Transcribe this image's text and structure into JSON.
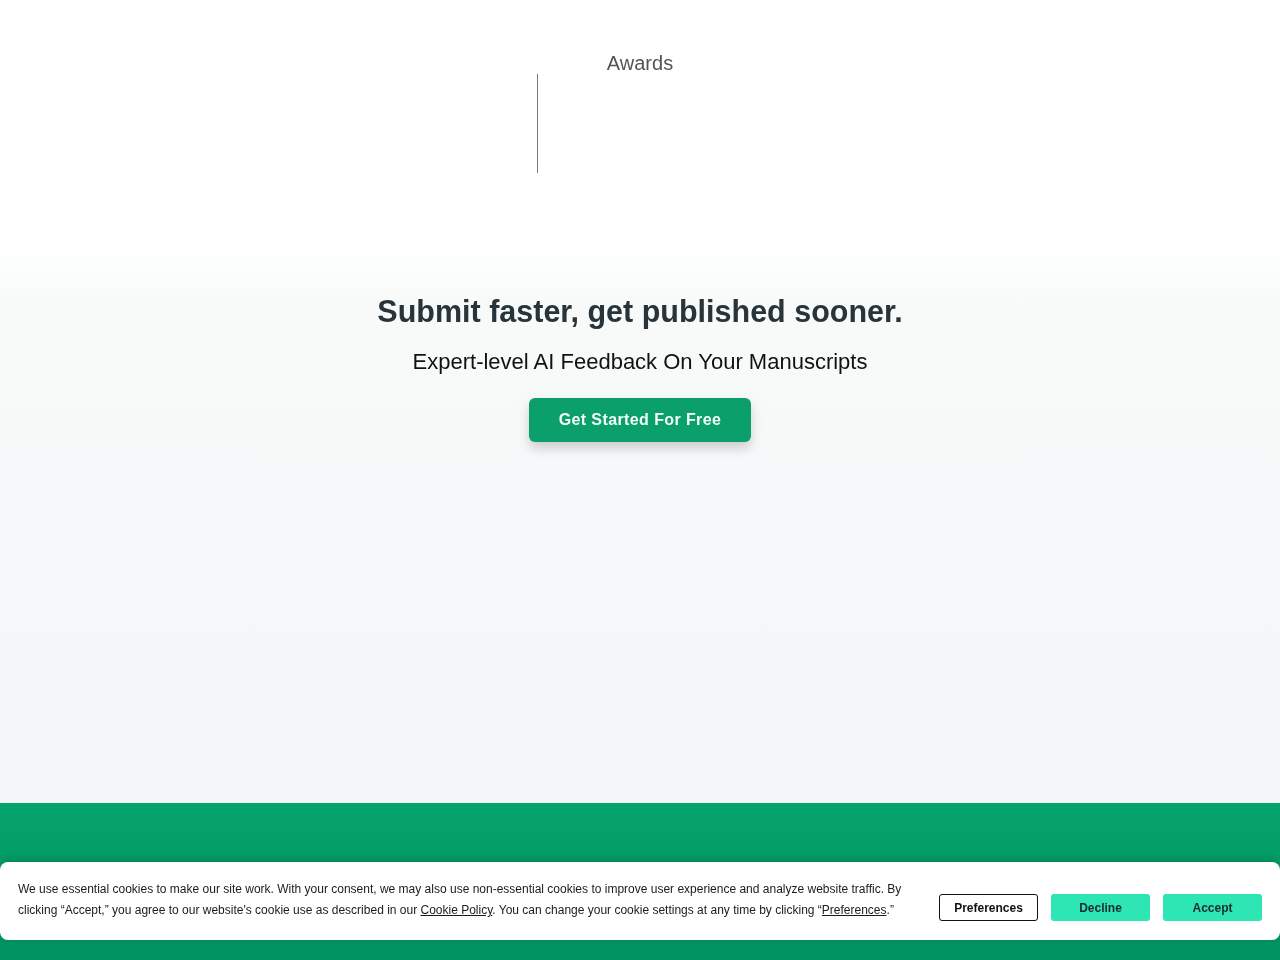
{
  "top": {
    "label": "Awards"
  },
  "hero": {
    "title": "Submit faster, get published sooner.",
    "subtitle": "Expert-level AI Feedback On Your Manuscripts",
    "cta": "Get Started For Free"
  },
  "cookie_banner": {
    "message": [
      {
        "kind": "text",
        "text": "We use essential cookies to make our site work. With your consent, we may also use non-essential cookies to improve user experience and analyze website traffic. By clicking “Accept,” you agree to our website's cookie use as described in our "
      },
      {
        "kind": "link",
        "text": "Cookie Policy"
      },
      {
        "kind": "text",
        "text": ". You can change your cookie settings at any time by clicking “"
      },
      {
        "kind": "link",
        "text": "Preferences"
      },
      {
        "kind": "text",
        "text": ".”"
      }
    ],
    "buttons": [
      {
        "label": "Preferences",
        "kind": "outline"
      },
      {
        "label": "Decline",
        "kind": "filled"
      },
      {
        "label": "Accept",
        "kind": "filled"
      }
    ]
  }
}
